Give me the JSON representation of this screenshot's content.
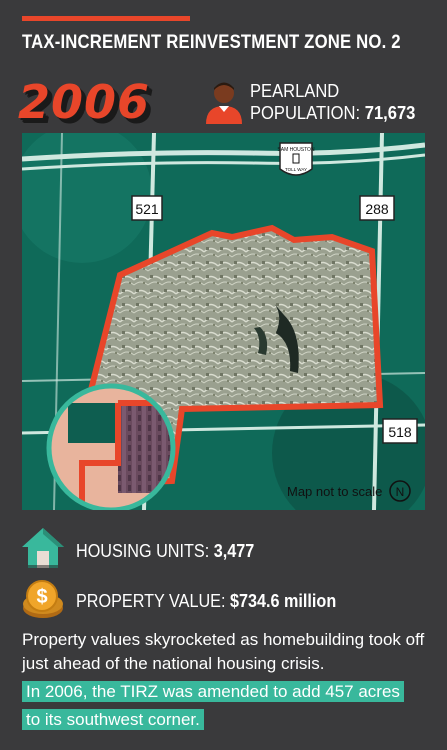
{
  "header": {
    "title": "TAX-INCREMENT REINVESTMENT ZONE NO. 2",
    "year": "2006"
  },
  "population": {
    "line1": "PEARLAND",
    "label": "POPULATION:",
    "value": "71,673"
  },
  "map": {
    "highways": [
      "521",
      "288",
      "518"
    ],
    "tollway_sign": [
      "SAM HOUSTON",
      "TOLL WAY"
    ],
    "note": "Map not to scale",
    "north": "N"
  },
  "stats": {
    "housing_label": "HOUSING UNITS:",
    "housing_value": "3,477",
    "property_label": "PROPERTY VALUE:",
    "property_value": "$734.6 million"
  },
  "description": {
    "main": "Property values skyrocketed as homebuilding took off just ahead of the national housing crisis.",
    "highlight": "In 2006, the TIRZ was amended to add 457 acres to its southwest corner."
  },
  "colors": {
    "background": "#3a3a3c",
    "accent_red": "#e8462a",
    "teal": "#39b89c",
    "map_green": "#0e5e50"
  },
  "icons": [
    "person-icon",
    "house-icon",
    "dollar-coin-icon",
    "north-arrow-icon"
  ]
}
